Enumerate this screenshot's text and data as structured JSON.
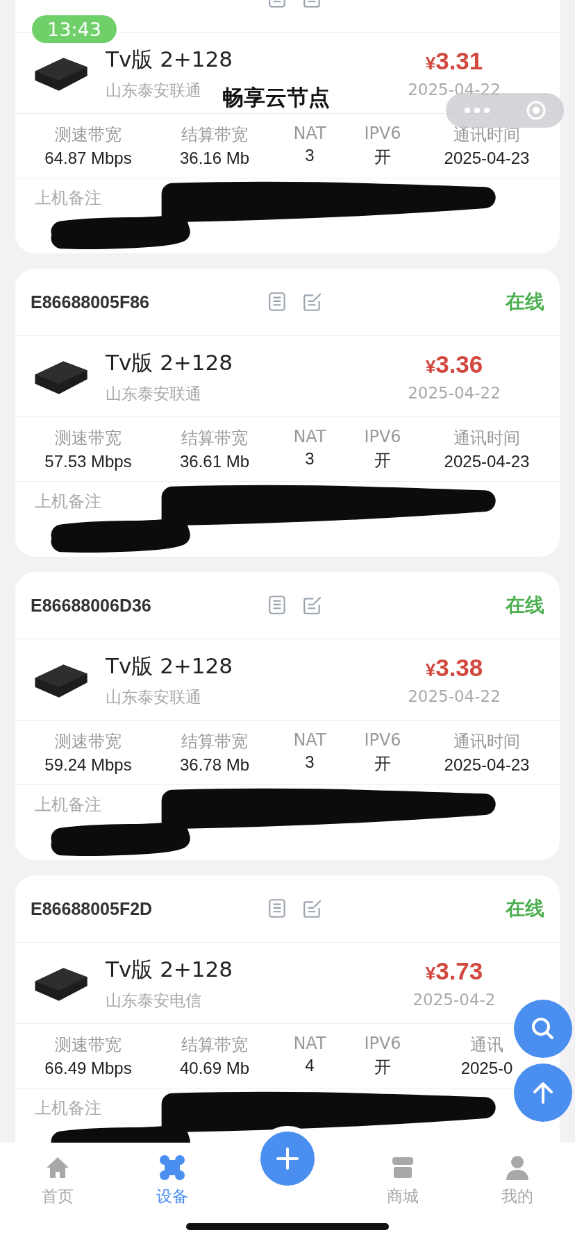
{
  "overlay": {
    "time": "13:43",
    "caption": "畅享云节点"
  },
  "devices": [
    {
      "name": "Tv版 2+128",
      "location": "山东泰安联通",
      "price_symbol": "¥",
      "price": "3.31",
      "date": "2025-04-22",
      "stats": [
        {
          "label": "测速带宽",
          "value": "64.87 Mbps"
        },
        {
          "label": "结算带宽",
          "value": "36.16 Mb"
        },
        {
          "label": "NAT",
          "value": "3"
        },
        {
          "label": "IPV6",
          "value": "开"
        },
        {
          "label": "通讯时间",
          "value": "2025-04-23"
        }
      ],
      "remark_label": "上机备注"
    },
    {
      "id": "E86688005F86",
      "status": "在线",
      "name": "Tv版 2+128",
      "location": "山东泰安联通",
      "price_symbol": "¥",
      "price": "3.36",
      "date": "2025-04-22",
      "stats": [
        {
          "label": "测速带宽",
          "value": "57.53 Mbps"
        },
        {
          "label": "结算带宽",
          "value": "36.61 Mb"
        },
        {
          "label": "NAT",
          "value": "3"
        },
        {
          "label": "IPV6",
          "value": "开"
        },
        {
          "label": "通讯时间",
          "value": "2025-04-23"
        }
      ],
      "remark_label": "上机备注"
    },
    {
      "id": "E86688006D36",
      "status": "在线",
      "name": "Tv版 2+128",
      "location": "山东泰安联通",
      "price_symbol": "¥",
      "price": "3.38",
      "date": "2025-04-22",
      "stats": [
        {
          "label": "测速带宽",
          "value": "59.24 Mbps"
        },
        {
          "label": "结算带宽",
          "value": "36.78 Mb"
        },
        {
          "label": "NAT",
          "value": "3"
        },
        {
          "label": "IPV6",
          "value": "开"
        },
        {
          "label": "通讯时间",
          "value": "2025-04-23"
        }
      ],
      "remark_label": "上机备注"
    },
    {
      "id": "E86688005F2D",
      "status": "在线",
      "name": "Tv版 2+128",
      "location": "山东泰安电信",
      "price_symbol": "¥",
      "price": "3.73",
      "date": "2025-04-2",
      "stats": [
        {
          "label": "测速带宽",
          "value": "66.49 Mbps"
        },
        {
          "label": "结算带宽",
          "value": "40.69 Mb"
        },
        {
          "label": "NAT",
          "value": "4"
        },
        {
          "label": "IPV6",
          "value": "开"
        },
        {
          "label": "通讯",
          "value": "2025-0"
        }
      ],
      "remark_label": "上机备注"
    }
  ],
  "tabs": [
    {
      "kind": "home",
      "label": "首页",
      "selected": false
    },
    {
      "kind": "device",
      "label": "设备",
      "selected": true
    },
    {
      "kind": "add"
    },
    {
      "kind": "shop",
      "label": "商城",
      "selected": false
    },
    {
      "kind": "me",
      "label": "我的",
      "selected": false
    }
  ]
}
